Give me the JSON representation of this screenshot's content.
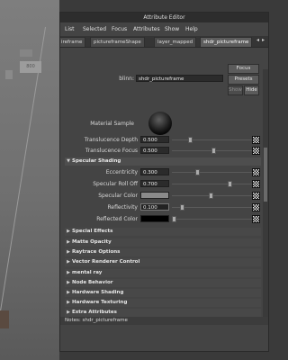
{
  "viewport": {
    "badge": "800"
  },
  "window": {
    "title": "Attribute Editor"
  },
  "menu": [
    "List",
    "Selected",
    "Focus",
    "Attributes",
    "Show",
    "Help"
  ],
  "tabs": [
    "ireframe",
    "pictureframeShape",
    "layer_mapped",
    "shdr_pictureframe"
  ],
  "header": {
    "blinn_label": "blinn:",
    "blinn_value": "shdr_pictureframe",
    "focus_label": "Focus",
    "presets_label": "Presets",
    "show_label": "Show",
    "hide_label": "Hide"
  },
  "material_sample_label": "Material Sample",
  "translucence": {
    "depth_label": "Translucence Depth",
    "depth_value": "0.500",
    "depth_level": 0.2,
    "focus_label": "Translucence Focus",
    "focus_value": "0.500",
    "focus_level": 0.5
  },
  "specular": {
    "section_label": "Specular Shading",
    "eccentricity_label": "Eccentricity",
    "eccentricity_value": "0.300",
    "eccentricity_level": 0.3,
    "rolloff_label": "Specular Roll Off",
    "rolloff_value": "0.700",
    "rolloff_level": 0.7,
    "color_label": "Specular Color",
    "color_swatch": "#8a8a8a",
    "reflectivity_label": "Reflectivity",
    "reflectivity_value": "0.100",
    "reflectivity_level": 0.1,
    "reflected_label": "Reflected Color",
    "reflected_swatch": "#000000"
  },
  "collapsed_sections": [
    "Special Effects",
    "Matte Opacity",
    "Raytrace Options",
    "Vector Renderer Control",
    "mental ray",
    "Node Behavior",
    "Hardware Shading",
    "Hardware Texturing",
    "Extra Attributes"
  ],
  "notes": {
    "label": "Notes:",
    "value": "shdr_pictureframe"
  }
}
